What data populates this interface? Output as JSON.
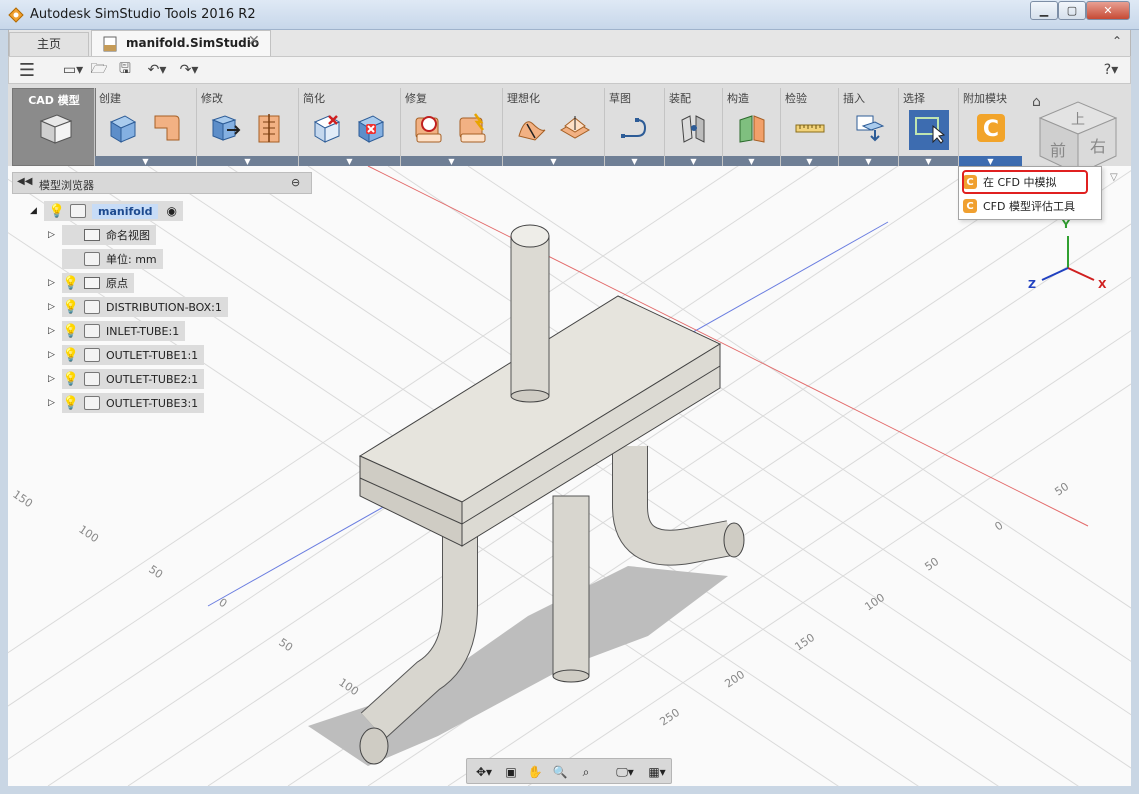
{
  "window": {
    "title": "Autodesk SimStudio Tools 2016 R2"
  },
  "tabs": {
    "home": "主页",
    "document": "manifold.SimStudio"
  },
  "ribbon": {
    "workspace": "CAD 模型",
    "groups": [
      "创建",
      "修改",
      "简化",
      "修复",
      "理想化",
      "草图",
      "装配",
      "构造",
      "检验",
      "插入",
      "选择",
      "附加模块"
    ]
  },
  "addon_menu": {
    "items": [
      {
        "label": "在 CFD 中模拟",
        "highlighted": true
      },
      {
        "label": "CFD 模型评估工具",
        "highlighted": false
      }
    ]
  },
  "browser": {
    "title": "模型浏览器",
    "root": "manifold",
    "items": [
      {
        "label": "命名视图",
        "kind": "folder",
        "bulb": false
      },
      {
        "label": "单位: mm",
        "kind": "doc",
        "bulb": false
      },
      {
        "label": "原点",
        "kind": "folder",
        "bulb": true
      },
      {
        "label": "DISTRIBUTION-BOX:1",
        "kind": "body",
        "bulb": true
      },
      {
        "label": "INLET-TUBE:1",
        "kind": "body",
        "bulb": true
      },
      {
        "label": "OUTLET-TUBE1:1",
        "kind": "body",
        "bulb": true
      },
      {
        "label": "OUTLET-TUBE2:1",
        "kind": "body",
        "bulb": true
      },
      {
        "label": "OUTLET-TUBE3:1",
        "kind": "body",
        "bulb": true
      }
    ]
  },
  "viewcube": {
    "top": "上",
    "front": "前",
    "right": "右"
  },
  "axes": {
    "x": "X",
    "y": "Y",
    "z": "Z"
  },
  "grid_labels": {
    "left": [
      "150",
      "100",
      "50",
      "0",
      "50",
      "100"
    ],
    "right": [
      "50",
      "0",
      "50",
      "100",
      "150",
      "200",
      "250"
    ]
  },
  "colors": {
    "accent": "#3d6cb0",
    "highlight": "#e02020",
    "addon": "#f0a030"
  }
}
